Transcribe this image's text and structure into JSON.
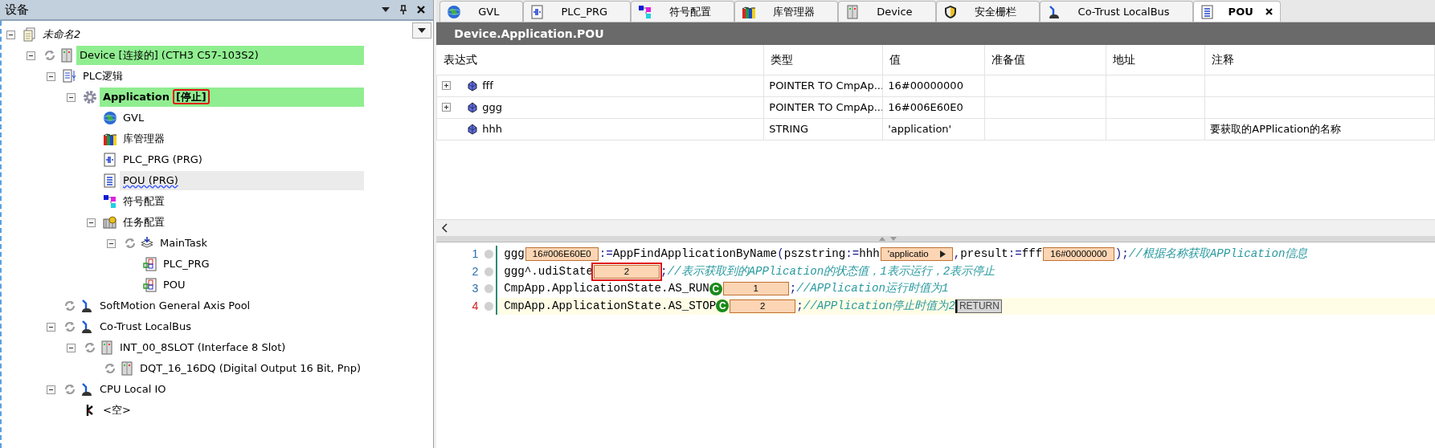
{
  "devices_panel": {
    "title": "设备",
    "tree": [
      {
        "label": "未命名2",
        "kind": "project",
        "expanded": true,
        "selected": false,
        "highlighted": false,
        "children": [
          {
            "label": "Device [连接的] (CTH3 C57-103S2)",
            "kind": "device",
            "expanded": true,
            "selected": false,
            "highlighted": true,
            "children": [
              {
                "label": "PLC逻辑",
                "kind": "plc-logic",
                "expanded": true,
                "selected": false,
                "highlighted": false,
                "children": [
                  {
                    "label": "Application",
                    "status": "[停止]",
                    "annotated": true,
                    "kind": "application",
                    "expanded": true,
                    "selected": false,
                    "highlighted": true,
                    "children": [
                      {
                        "label": "GVL",
                        "kind": "gvl",
                        "selected": false,
                        "highlighted": false
                      },
                      {
                        "label": "库管理器",
                        "kind": "library",
                        "selected": false,
                        "highlighted": false
                      },
                      {
                        "label": "PLC_PRG (PRG)",
                        "kind": "program",
                        "selected": false,
                        "highlighted": false
                      },
                      {
                        "label": "POU (PRG)",
                        "kind": "pou",
                        "selected": true,
                        "highlighted": false,
                        "flagged": true
                      },
                      {
                        "label": "符号配置",
                        "kind": "symbol-config",
                        "selected": false,
                        "highlighted": false
                      },
                      {
                        "label": "任务配置",
                        "kind": "task-config",
                        "expanded": true,
                        "selected": false,
                        "highlighted": false,
                        "children": [
                          {
                            "label": "MainTask",
                            "kind": "task",
                            "expanded": true,
                            "selected": false,
                            "highlighted": false,
                            "children": [
                              {
                                "label": "PLC_PRG",
                                "kind": "task-call",
                                "selected": false,
                                "highlighted": false
                              },
                              {
                                "label": "POU",
                                "kind": "task-call",
                                "selected": false,
                                "highlighted": false
                              }
                            ]
                          }
                        ]
                      }
                    ]
                  }
                ]
              },
              {
                "label": "SoftMotion General Axis Pool",
                "kind": "motion",
                "selected": false,
                "highlighted": false
              },
              {
                "label": "Co-Trust LocalBus",
                "kind": "motion",
                "expanded": true,
                "selected": false,
                "highlighted": false,
                "children": [
                  {
                    "label": "INT_00_8SLOT (Interface 8 Slot)",
                    "kind": "module",
                    "expanded": true,
                    "selected": false,
                    "highlighted": false,
                    "children": [
                      {
                        "label": "DQT_16_16DQ (Digital Output 16 Bit, Pnp)",
                        "kind": "module",
                        "selected": false,
                        "highlighted": false
                      }
                    ]
                  }
                ]
              },
              {
                "label": "CPU Local IO",
                "kind": "motion",
                "expanded": true,
                "selected": false,
                "highlighted": false,
                "children": [
                  {
                    "label": "<空>",
                    "kind": "connector",
                    "selected": false,
                    "highlighted": false
                  }
                ]
              }
            ]
          }
        ]
      }
    ]
  },
  "tabs": [
    {
      "label": "GVL",
      "kind": "gvl",
      "selected": false
    },
    {
      "label": "PLC_PRG",
      "kind": "program",
      "selected": false
    },
    {
      "label": "符号配置",
      "kind": "symbol-config",
      "selected": false
    },
    {
      "label": "库管理器",
      "kind": "library",
      "selected": false
    },
    {
      "label": "Device",
      "kind": "device",
      "selected": false
    },
    {
      "label": "安全栅栏",
      "kind": "safety",
      "selected": false
    },
    {
      "label": "Co-Trust LocalBus",
      "kind": "motion",
      "selected": false
    },
    {
      "label": "POU",
      "kind": "pou",
      "selected": true,
      "closable": true
    }
  ],
  "editor": {
    "title": "Device.Application.POU",
    "table": {
      "columns": [
        "表达式",
        "类型",
        "值",
        "准备值",
        "地址",
        "注释"
      ],
      "rows": [
        {
          "expression": "fff",
          "type": "POINTER TO CmpAp...",
          "value": "16#00000000",
          "expandable": true,
          "expanded": false
        },
        {
          "expression": "ggg",
          "type": "POINTER TO CmpAp...",
          "value": "16#006E60E0",
          "expandable": true,
          "expanded": false
        },
        {
          "expression": "hhh",
          "type": "STRING",
          "value": "'application'",
          "comment": "要获取的APPlication的名称",
          "expandable": false
        }
      ]
    },
    "code_lines": [
      {
        "number": "1",
        "current": false,
        "segments": [
          {
            "kind": "code",
            "text": "ggg"
          },
          {
            "kind": "value",
            "text": "16#006E60E0"
          },
          {
            "kind": "op",
            "text": ":="
          },
          {
            "kind": "code",
            "text": "AppFindApplicationByName"
          },
          {
            "kind": "op",
            "text": "("
          },
          {
            "kind": "code",
            "text": "pszstring"
          },
          {
            "kind": "op",
            "text": ":="
          },
          {
            "kind": "code",
            "text": "hhh"
          },
          {
            "kind": "value",
            "text": "'applicatio",
            "more": true
          },
          {
            "kind": "op",
            "text": ","
          },
          {
            "kind": "code",
            "text": "presult"
          },
          {
            "kind": "op",
            "text": ":="
          },
          {
            "kind": "code",
            "text": "fff"
          },
          {
            "kind": "value",
            "text": "16#00000000"
          },
          {
            "kind": "op",
            "text": ");"
          },
          {
            "kind": "comment",
            "text": "//根据名称获取APPlication信息"
          }
        ]
      },
      {
        "number": "2",
        "current": false,
        "segments": [
          {
            "kind": "code",
            "text": "ggg^.udiState"
          },
          {
            "kind": "value",
            "text": "2",
            "annotated": true
          },
          {
            "kind": "op",
            "text": ";"
          },
          {
            "kind": "comment",
            "text": "//表示获取到的APPlication的状态值，1表示运行，2表示停止"
          }
        ]
      },
      {
        "number": "3",
        "current": false,
        "segments": [
          {
            "kind": "code",
            "text": "CmpApp.ApplicationState.AS_RUN"
          },
          {
            "kind": "badge",
            "text": "C"
          },
          {
            "kind": "value",
            "text": "1"
          },
          {
            "kind": "op",
            "text": ";"
          },
          {
            "kind": "comment",
            "text": "//APPlication运行时值为1"
          }
        ]
      },
      {
        "number": "4",
        "current": true,
        "segments": [
          {
            "kind": "code",
            "text": "CmpApp.ApplicationState.AS_STOP"
          },
          {
            "kind": "badge",
            "text": "C"
          },
          {
            "kind": "value",
            "text": "2"
          },
          {
            "kind": "op",
            "text": ";"
          },
          {
            "kind": "comment",
            "text": "//APPlication停止时值为2"
          },
          {
            "kind": "cursor"
          },
          {
            "kind": "hint",
            "text": "RETURN"
          }
        ]
      }
    ]
  }
}
